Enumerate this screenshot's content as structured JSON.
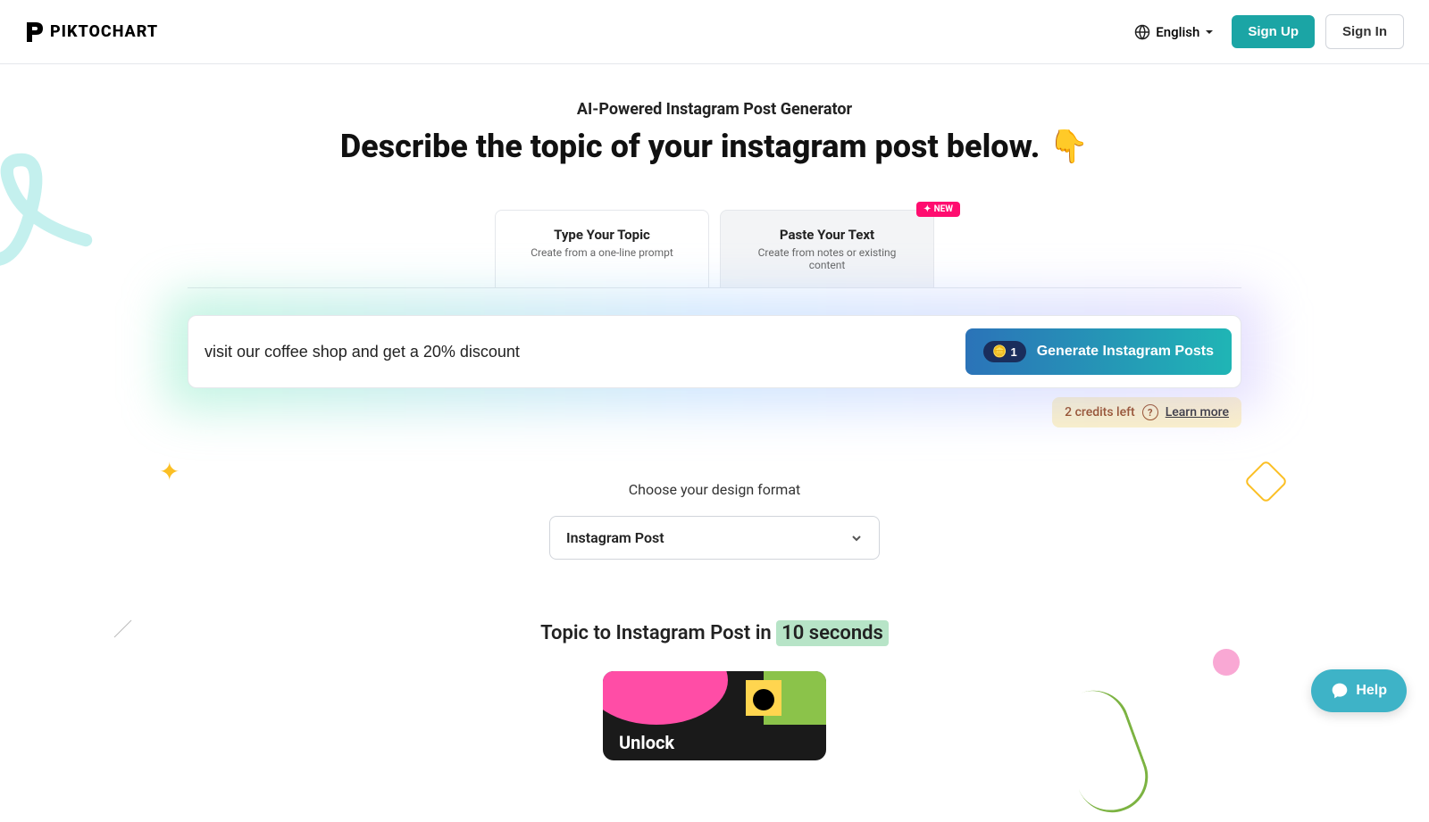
{
  "header": {
    "logo_text": "PIKTOCHART",
    "language": "English",
    "signup": "Sign Up",
    "signin": "Sign In"
  },
  "hero": {
    "subtitle": "AI-Powered Instagram Post Generator",
    "title": "Describe the topic of your instagram post below.",
    "emoji": "👇"
  },
  "tabs": [
    {
      "title": "Type Your Topic",
      "sub": "Create from a one-line prompt"
    },
    {
      "title": "Paste Your Text",
      "sub": "Create from notes or existing content",
      "badge": "NEW"
    }
  ],
  "input": {
    "value": "visit our coffee shop and get a 20% discount",
    "credit_cost": "1",
    "generate_label": "Generate Instagram Posts"
  },
  "credits": {
    "left_text": "2 credits left",
    "learn_more": "Learn more"
  },
  "format": {
    "label": "Choose your design format",
    "selected": "Instagram Post"
  },
  "section": {
    "prefix": "Topic to Instagram Post in ",
    "highlight": "10 seconds"
  },
  "preview": {
    "text": "Unlock"
  },
  "help_fab": "Help"
}
